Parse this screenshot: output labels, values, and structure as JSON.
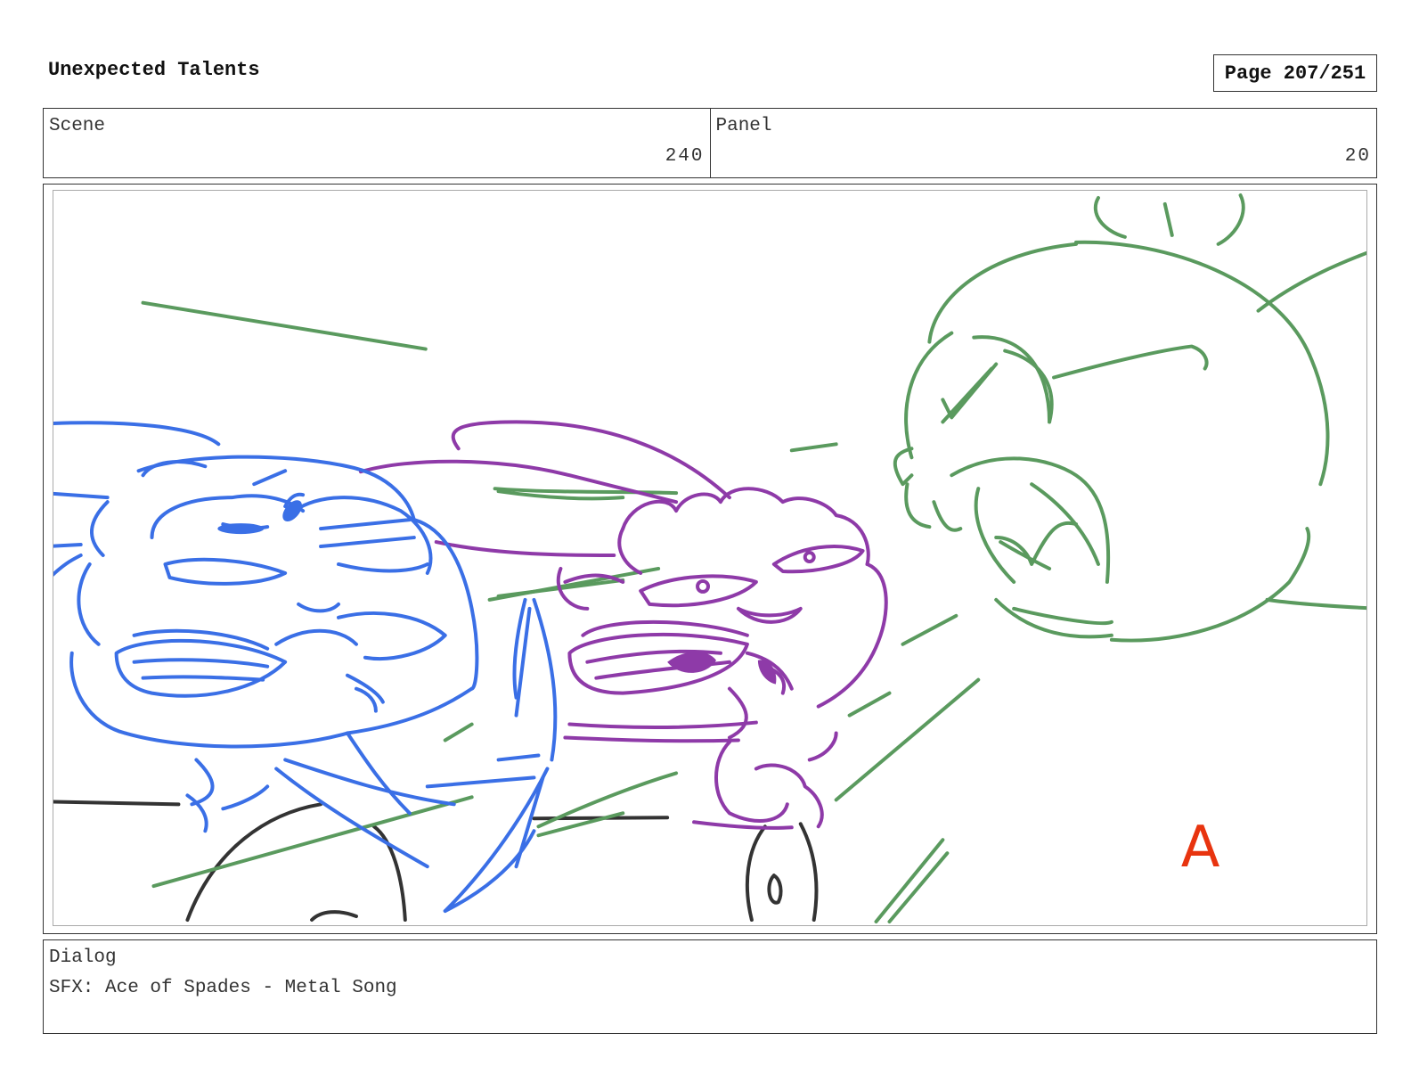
{
  "header": {
    "title": "Unexpected Talents",
    "page": "Page 207/251"
  },
  "info": {
    "scene_label": "Scene",
    "scene_value": "240",
    "panel_label": "Panel",
    "panel_value": "20"
  },
  "panel": {
    "corner_mark": "A",
    "colors": {
      "blue_character": "#3a6fe6",
      "purple_character": "#8e3aa8",
      "green_character": "#5a9a5e",
      "props": "#333333",
      "mark": "#e8340f"
    }
  },
  "dialog": {
    "label": "Dialog",
    "text": "SFX: Ace of Spades - Metal Song"
  }
}
